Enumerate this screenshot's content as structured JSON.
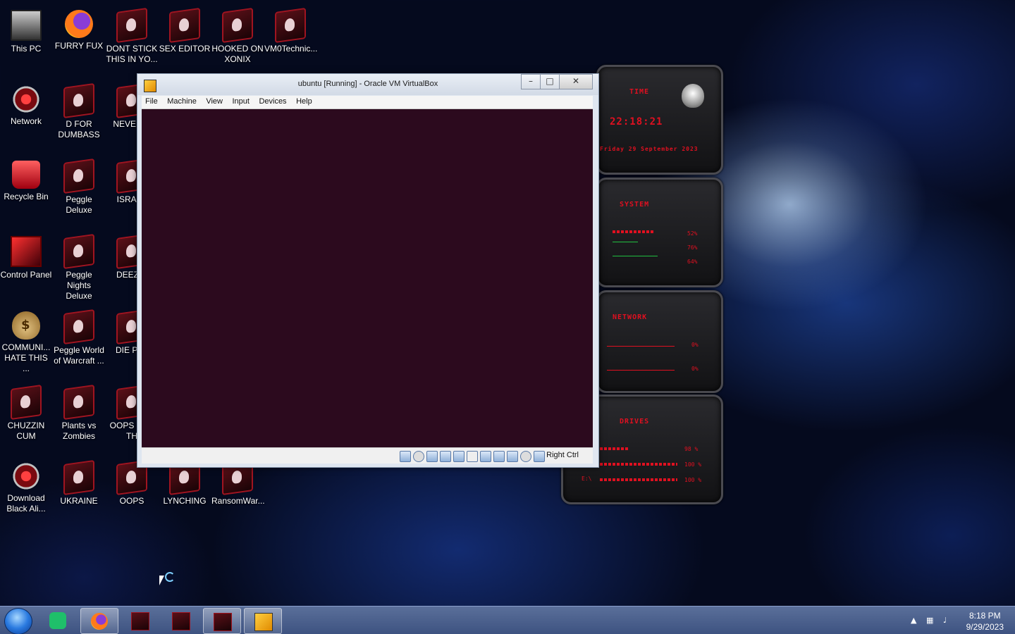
{
  "desktop": {
    "icons": [
      {
        "label": "This PC",
        "kind": "pc"
      },
      {
        "label": "FURRY FUX",
        "kind": "firefox"
      },
      {
        "label": "DONT STICK THIS IN YO...",
        "kind": "alien"
      },
      {
        "label": "SEX EDITOR",
        "kind": "alien"
      },
      {
        "label": "HOOKED ON XONIX",
        "kind": "alien"
      },
      {
        "label": "VM0Technic...",
        "kind": "alien"
      },
      {
        "label": "Network",
        "kind": "network"
      },
      {
        "label": "D FOR DUMBASS",
        "kind": "alien"
      },
      {
        "label": "NEVER U",
        "kind": "alien"
      },
      {
        "label": "Recycle Bin",
        "kind": "bin"
      },
      {
        "label": "Peggle Deluxe",
        "kind": "alien"
      },
      {
        "label": "ISRAEL",
        "kind": "alien"
      },
      {
        "label": "Control Panel",
        "kind": "controlpanel"
      },
      {
        "label": "Peggle Nights Deluxe",
        "kind": "alien"
      },
      {
        "label": "DEEZ N",
        "kind": "alien"
      },
      {
        "label": "COMMUNI... HATE THIS ...",
        "kind": "money"
      },
      {
        "label": "Peggle World of Warcraft ...",
        "kind": "alien"
      },
      {
        "label": "DIE PLE",
        "kind": "alien"
      },
      {
        "label": "CHUZZIN CUM",
        "kind": "alien"
      },
      {
        "label": "Plants vs Zombies",
        "kind": "alien"
      },
      {
        "label": "OOPS I DO TH",
        "kind": "alien"
      },
      {
        "label": "Download Black Ali...",
        "kind": "network"
      },
      {
        "label": "UKRAINE",
        "kind": "alien"
      },
      {
        "label": "OOPS",
        "kind": "alien"
      },
      {
        "label": "LYNCHING",
        "kind": "alien"
      },
      {
        "label": "RansomWar...",
        "kind": "alien"
      }
    ]
  },
  "window": {
    "title": "ubuntu [Running] - Oracle VM VirtualBox",
    "menu": [
      "File",
      "Machine",
      "View",
      "Input",
      "Devices",
      "Help"
    ],
    "host_key": "Right Ctrl",
    "guest_bg": "#2c0a1e"
  },
  "gadget": {
    "time_label": "TIME",
    "clock": "22:18:21",
    "date": "Friday 29 September 2023",
    "system_label": "SYSTEM",
    "system_values": [
      "52%",
      "76%",
      "64%"
    ],
    "network_label": "NETWORK",
    "network_values": [
      "0%",
      "0%"
    ],
    "drives_label": "DRIVES",
    "drive_values": [
      "98 %",
      "100 %",
      "100 %"
    ],
    "drive_letter": "E:\\",
    "accent": "#e01020"
  },
  "taskbar": {
    "time": "8:18 PM",
    "date": "9/29/2023"
  }
}
